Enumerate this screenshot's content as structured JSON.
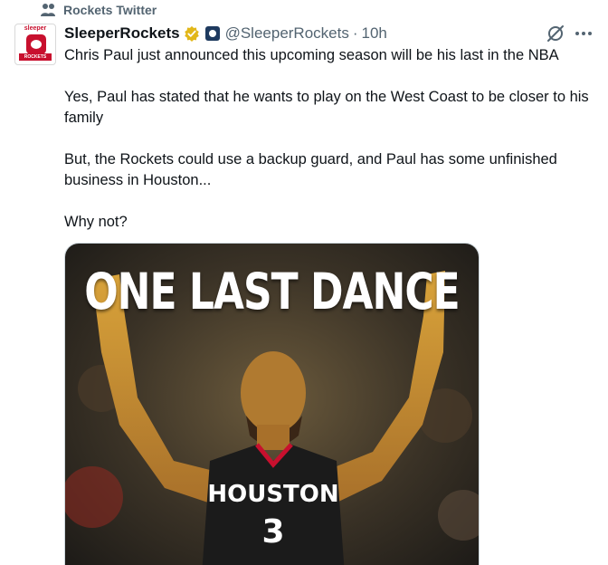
{
  "social_context": {
    "label": "Rockets Twitter",
    "icon": "community-icon"
  },
  "author": {
    "display_name": "SleeperRockets",
    "handle": "@SleeperRockets",
    "separator": "·",
    "time": "10h",
    "avatar": {
      "top_text": "sleeper",
      "bottom_text": "ROCKETS",
      "icon": "avatar-logo"
    }
  },
  "actions": {
    "grok_icon": "grok-icon",
    "more_icon": "more-icon"
  },
  "tweet": {
    "paragraphs": [
      "Chris Paul just announced this upcoming season will be his last in the NBA",
      "Yes, Paul has stated that he wants to play on the West Coast to be closer to his family",
      "But, the Rockets could use a backup guard, and Paul has some unfinished business in Houston...",
      "Why not?"
    ]
  },
  "media": {
    "caption": "ONE LAST DANCE",
    "jersey_text": "HOUSTON",
    "jersey_number": "3"
  },
  "colors": {
    "text": "#0f1419",
    "secondary": "#536471",
    "verified_gold": "#e2b719",
    "rockets_red": "#c8102e"
  }
}
